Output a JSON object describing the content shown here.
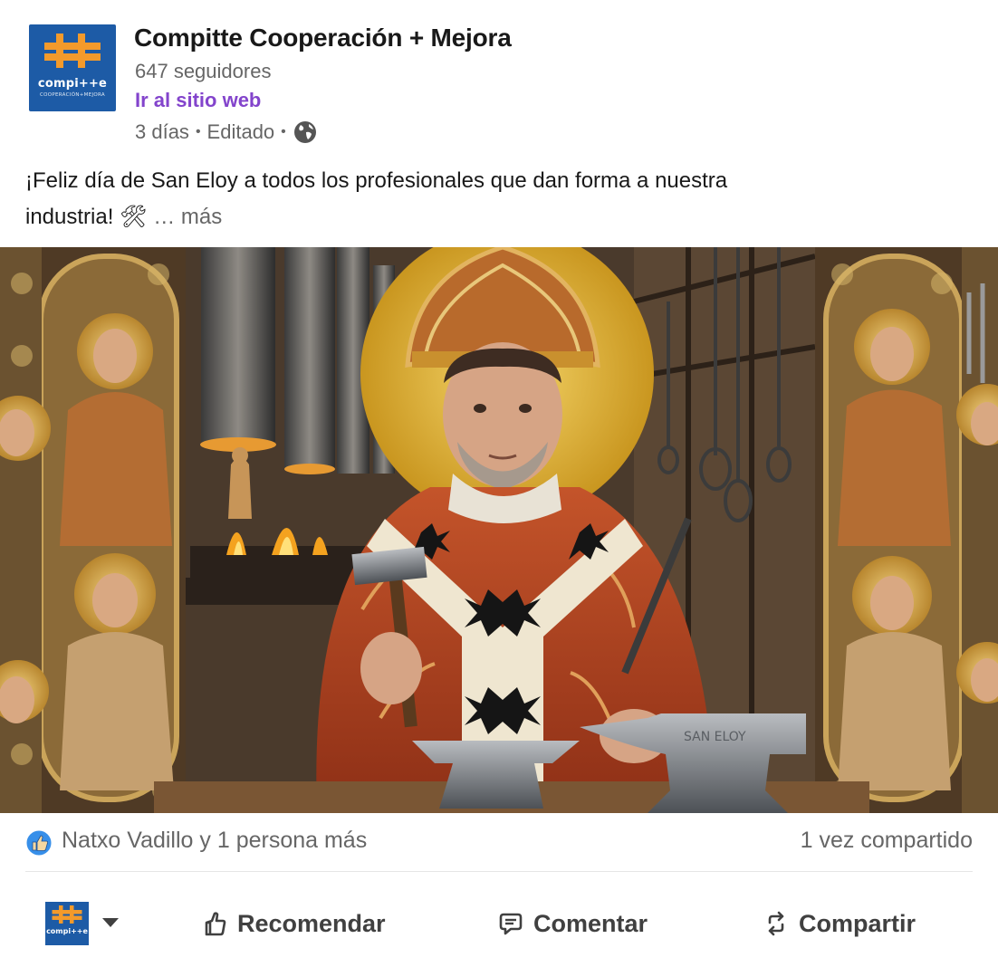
{
  "post": {
    "author": {
      "name": "Compitte Cooperación + Mejora",
      "followers": "647 seguidores",
      "website_link": "Ir al sitio web",
      "time": "3 días",
      "edited": "Editado",
      "logo_text": "compi++e",
      "logo_tagline": "COOPERACIÓN+MEJORA"
    },
    "text_line1": "¡Feliz día de San Eloy a todos los profesionales que dan forma a nuestra",
    "text_line2": "industria! 🛠",
    "more_label": "… más",
    "image_signature": "SAN ELOY"
  },
  "social": {
    "reactions": "Natxo Vadillo y 1 persona más",
    "shares": "1 vez compartido"
  },
  "actions": {
    "recommend": "Recomendar",
    "comment": "Comentar",
    "share": "Compartir"
  },
  "icons": [
    "globe-icon",
    "like-reaction-icon",
    "recommend-icon",
    "comment-icon",
    "share-icon",
    "chevron-down-icon"
  ],
  "colors": {
    "brand_blue": "#1d5ba6",
    "brand_orange": "#f39a2b",
    "link_purple": "#8344cc",
    "like_blue": "#378fe9"
  }
}
